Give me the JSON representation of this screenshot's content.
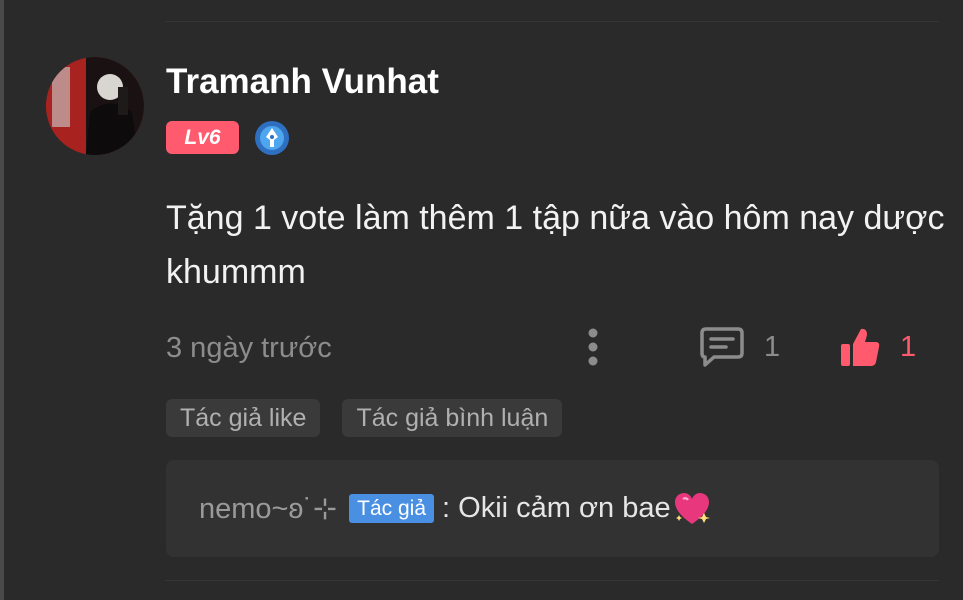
{
  "comment": {
    "username": "Tramanh Vunhat",
    "level": "Lv6",
    "text": "Tặng 1 vote làm thêm 1 tập nữa vào hôm nay dược khummm",
    "timestamp": "3 ngày trước",
    "reply_count": "1",
    "like_count": "1",
    "badges": [
      "Tác giả like",
      "Tác giả bình luận"
    ]
  },
  "reply": {
    "name": "nemo~ʚ˙⊹",
    "author_tag": "Tác giả",
    "message": ": Okii cảm ơn bae"
  },
  "colors": {
    "accent": "#ff5a6e",
    "author_tag": "#4a90e2",
    "background": "#2a2a2b",
    "badge_bg": "#3a3a3b"
  },
  "icons": [
    "avatar",
    "author-icon",
    "more-vertical-icon",
    "comment-icon",
    "thumbs-up-icon",
    "sparkling-heart-icon"
  ]
}
